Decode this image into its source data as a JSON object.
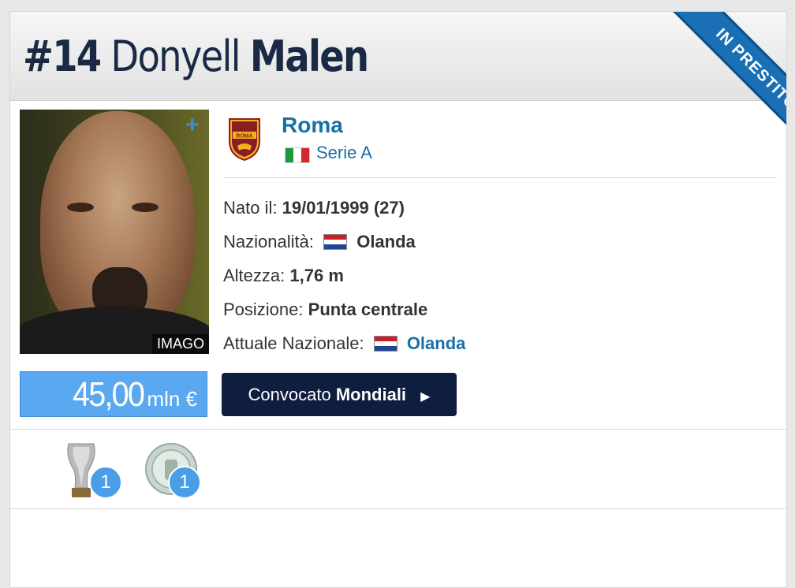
{
  "header": {
    "number": "#14",
    "first_name": "Donyell",
    "last_name": "Malen",
    "ribbon": "IN PRESTITO"
  },
  "photo": {
    "credit": "IMAGO"
  },
  "market_value": {
    "amount": "45,00",
    "unit": "mln €"
  },
  "club": {
    "name": "Roma",
    "league": "Serie A"
  },
  "info": {
    "born_label": "Nato il:",
    "born_value": "19/01/1999 (27)",
    "nationality_label": "Nazionalità:",
    "nationality_value": "Olanda",
    "height_label": "Altezza:",
    "height_value": "1,76 m",
    "position_label": "Posizione:",
    "position_value": "Punta centrale",
    "national_team_label": "Attuale Nazionale:",
    "national_team_value": "Olanda"
  },
  "cta": {
    "prefix": "Convocato",
    "bold": "Mondiali"
  },
  "trophies": [
    {
      "icon": "europa-league-trophy-icon",
      "count": "1"
    },
    {
      "icon": "plate-trophy-icon",
      "count": "1"
    }
  ],
  "colors": {
    "accent": "#1a6fa6",
    "value_box": "#5aa8f0",
    "cta": "#0f1e3e",
    "ribbon": "#1a6fb5"
  }
}
